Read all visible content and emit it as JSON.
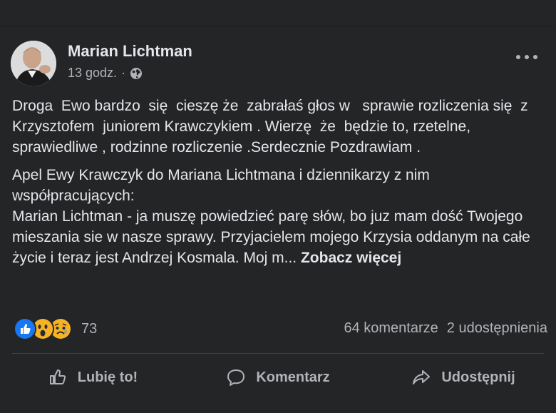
{
  "post": {
    "author": "Marian Lichtman",
    "time": "13 godz.",
    "separator": "·",
    "privacy_icon": "globe-icon",
    "paragraph1": "Droga  Ewo bardzo  się  cieszę że  zabrałaś głos w   sprawie rozliczenia się  z Krzysztofem  juniorem Krawczykiem . Wierzę  że  będzie to, rzetelne, sprawiedliwe , rodzinne rozliczenie .Serdecznie Pozdrawiam .",
    "paragraph2": "Apel Ewy Krawczyk do Mariana Lichtmana i dziennikarzy z nim współpracujących:\nMarian Lichtman - ja muszę powiedzieć parę słów, bo juz mam dość Twojego mieszania sie w nasze sprawy. Przyjacielem mojego Krzysia oddanym na całe życie i teraz jest Andrzej Kosmala. Moj m... ",
    "see_more": "Zobacz więcej"
  },
  "reactions": {
    "icons": [
      "like-reaction-icon",
      "wow-reaction-icon",
      "sad-reaction-icon"
    ],
    "count": "73",
    "comments": "64 komentarze",
    "shares": "2 udostępnienia"
  },
  "actions": {
    "like": "Lubię to!",
    "comment": "Komentarz",
    "share": "Udostępnij"
  },
  "colors": {
    "background": "#242526",
    "text": "#e4e6eb",
    "secondary": "#b0b3b8",
    "like_blue": "#1877f2",
    "wow_yellow": "#f7b125"
  }
}
